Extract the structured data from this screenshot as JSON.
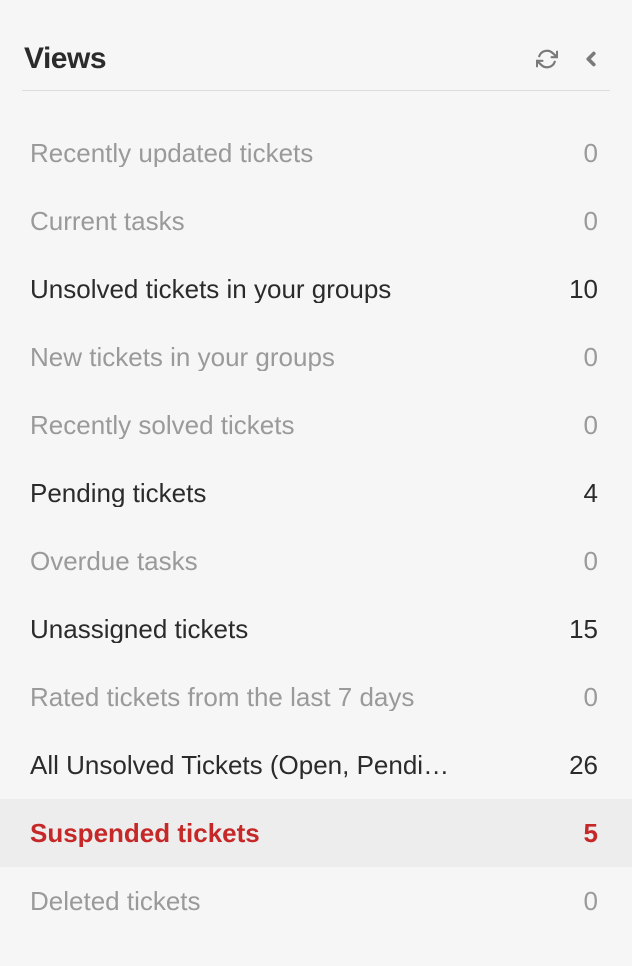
{
  "header": {
    "title": "Views"
  },
  "items": [
    {
      "label": "Recently updated tickets",
      "count": "0",
      "style": "muted",
      "selected": false
    },
    {
      "label": "Current tasks",
      "count": "0",
      "style": "muted",
      "selected": false
    },
    {
      "label": "Unsolved tickets in your groups",
      "count": "10",
      "style": "active",
      "selected": false
    },
    {
      "label": "New tickets in your groups",
      "count": "0",
      "style": "muted",
      "selected": false
    },
    {
      "label": "Recently solved tickets",
      "count": "0",
      "style": "muted",
      "selected": false
    },
    {
      "label": "Pending tickets",
      "count": "4",
      "style": "active",
      "selected": false
    },
    {
      "label": "Overdue tasks",
      "count": "0",
      "style": "muted",
      "selected": false
    },
    {
      "label": "Unassigned tickets",
      "count": "15",
      "style": "active",
      "selected": false
    },
    {
      "label": "Rated tickets from the last 7 days",
      "count": "0",
      "style": "muted",
      "selected": false
    },
    {
      "label": "All Unsolved Tickets (Open, Pendi…",
      "count": "26",
      "style": "active",
      "selected": false
    },
    {
      "label": "Suspended tickets",
      "count": "5",
      "style": "active",
      "selected": true
    },
    {
      "label": "Deleted tickets",
      "count": "0",
      "style": "muted",
      "selected": false
    }
  ]
}
